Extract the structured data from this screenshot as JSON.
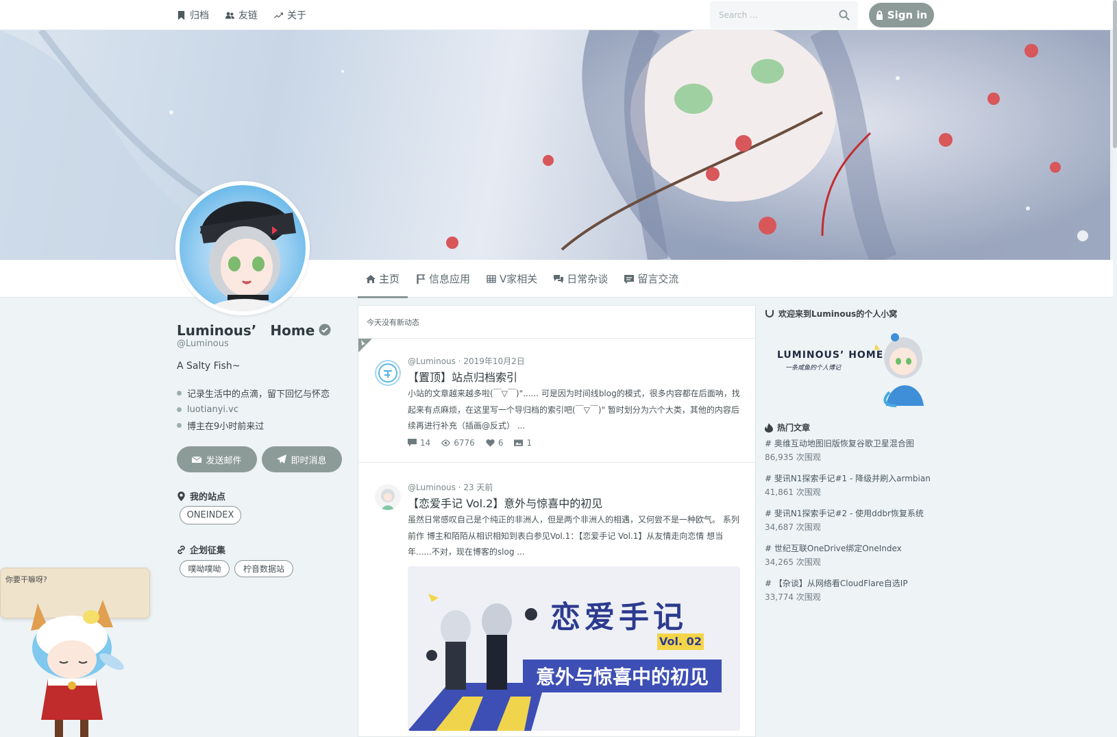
{
  "nav": {
    "links": [
      {
        "label": "归档",
        "icon": "bookmark-icon"
      },
      {
        "label": "友链",
        "icon": "users-icon"
      },
      {
        "label": "关于",
        "icon": "trend-icon"
      }
    ],
    "search_placeholder": "Search ...",
    "signin_label": "Sign in"
  },
  "tabs": [
    {
      "label": "主页",
      "icon": "home-icon",
      "active": true
    },
    {
      "label": "信息应用",
      "icon": "flag-icon"
    },
    {
      "label": "V家相关",
      "icon": "grid-icon"
    },
    {
      "label": "日常杂谈",
      "icon": "comments-icon"
    },
    {
      "label": "留言交流",
      "icon": "message-icon"
    }
  ],
  "profile": {
    "name": "Luminous’　Home",
    "handle": "@Luminous",
    "bio": "A Salty Fish~",
    "info": [
      "记录生活中的点滴，留下回忆与怀恋",
      "luotianyi.vc",
      "博主在9小时前来过"
    ],
    "email_button": "发送邮件",
    "message_button": "即时消息",
    "sites_title": "我的站点",
    "sites": [
      "ONEINDEX"
    ],
    "plans_title": "企划征集",
    "plans": [
      "噗呦噗呦",
      "柠音数据站"
    ]
  },
  "mascot": {
    "bubble_text": "你要干嘛呀?"
  },
  "feed": {
    "notice": "今天没有新动态",
    "posts": [
      {
        "meta": "@Luminous · 2019年10月2日",
        "title": "【置顶】站点归档索引",
        "excerpt": "小站的文章越来越多啦(￣▽￣)\"...... 可是因为时间线blog的模式，很多内容都在后面呐，找起来有点麻烦，在这里写一个导归档的索引吧(￣▽￣)\" 暂时划分为六个大类，其他的内容后续再进行补充（插画@反式） ...",
        "comments": "14",
        "views": "6776",
        "likes": "6",
        "images": "1"
      },
      {
        "meta": "@Luminous · 23 天前",
        "title": "【恋爱手记 Vol.2】意外与惊喜中的初见",
        "excerpt": "虽然日常感叹自己是个纯正的非洲人，但是两个非洲人的相遇，又何尝不是一种欧气。 系列前作 博主和陌陌从相识相知到表白参见Vol.1：【恋爱手记 Vol.1】从友情走向恋情 想当年......不对，现在博客的slog ...",
        "image_title": "恋爱手记",
        "image_vol": "Vol. 02",
        "image_subtitle": "意外与惊喜中的初见"
      }
    ]
  },
  "sidebar": {
    "welcome": "欢迎来到Luminous的个人小窝",
    "logo_text": "LUMINOUS’ HOME",
    "logo_sub": "一条咸鱼的个人博记",
    "hot_title": "热门文章",
    "hot": [
      {
        "title": "# 奥维互动地图旧版恢复谷歌卫星混合图",
        "views": "86,935 次围观"
      },
      {
        "title": "# 斐讯N1探索手记#1 - 降级并刷入armbian",
        "views": "41,861 次围观"
      },
      {
        "title": "# 斐讯N1探索手记#2 - 使用ddbr恢复系统",
        "views": "34,687 次围观"
      },
      {
        "title": "# 世纪互联OneDrive绑定OneIndex",
        "views": "34,265 次围观"
      },
      {
        "title": "# 【杂谈】从网络看CloudFlare自选IP",
        "views": "33,774 次围观"
      }
    ]
  },
  "colors": {
    "accent": "#8d9b98",
    "background": "#eef3f6"
  }
}
